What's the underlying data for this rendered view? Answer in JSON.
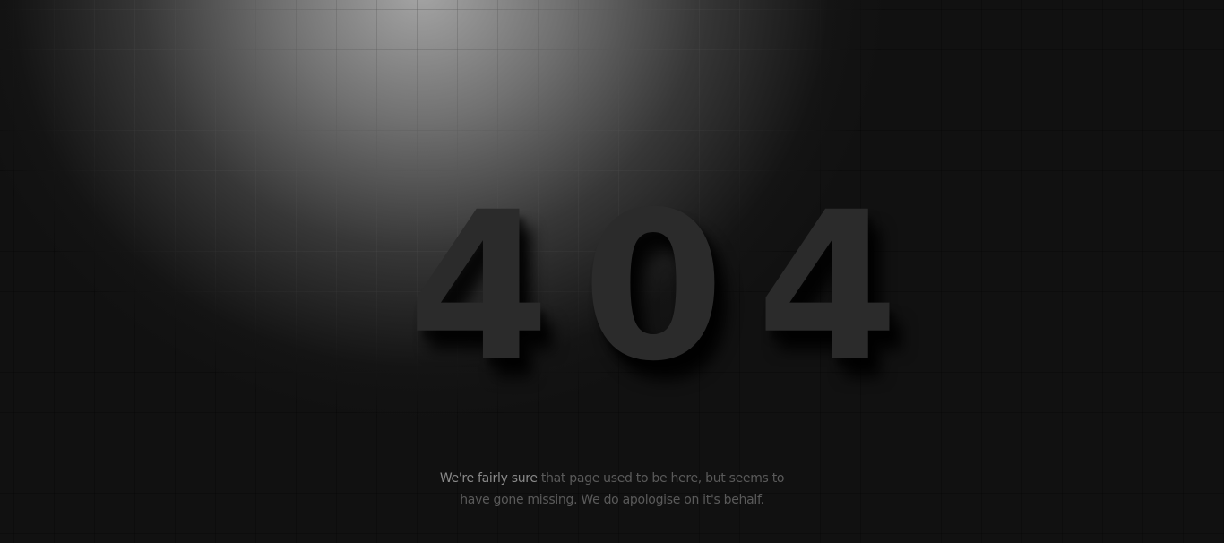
{
  "error": {
    "code": "404",
    "message_lead": "We're fairly sure",
    "message_rest": " that page used to be here, but seems to have gone missing. We do apologise on it's behalf."
  },
  "colors": {
    "background": "#111111",
    "spotlight": "#a5a5a5",
    "code_text": "#2b2b2b",
    "message_text": "#5a5a5a"
  }
}
